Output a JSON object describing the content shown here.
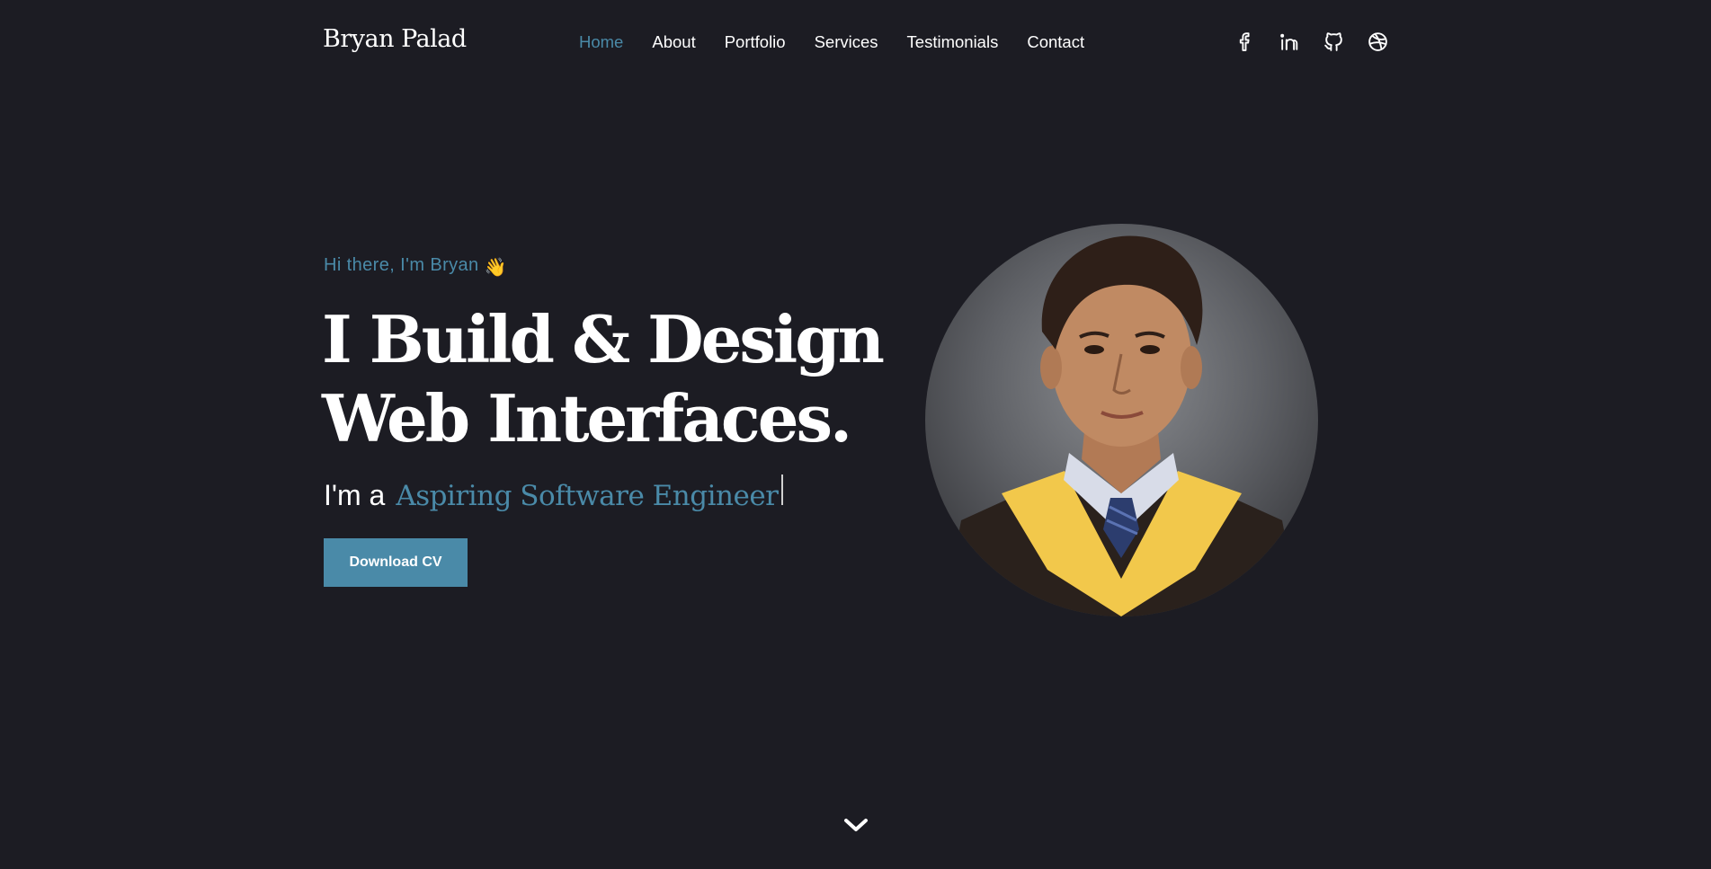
{
  "brand": "Bryan Palad",
  "nav": {
    "items": [
      {
        "label": "Home",
        "active": true
      },
      {
        "label": "About",
        "active": false
      },
      {
        "label": "Portfolio",
        "active": false
      },
      {
        "label": "Services",
        "active": false
      },
      {
        "label": "Testimonials",
        "active": false
      },
      {
        "label": "Contact",
        "active": false
      }
    ]
  },
  "socials": [
    {
      "icon": "facebook-icon"
    },
    {
      "icon": "linkedin-icon"
    },
    {
      "icon": "github-icon"
    },
    {
      "icon": "dribbble-icon"
    }
  ],
  "hero": {
    "greeting": "Hi there, I'm Bryan",
    "greeting_emoji": "👋",
    "headline_line1": "I Build & Design",
    "headline_line2": "Web Interfaces.",
    "role_prefix": "I'm a",
    "role_text": "Aspiring Software Engineer",
    "cta_label": "Download CV"
  },
  "colors": {
    "background": "#1c1c23",
    "accent": "#4a8aa8",
    "text": "#ffffff"
  },
  "scroll_icon": "chevron-down-icon"
}
